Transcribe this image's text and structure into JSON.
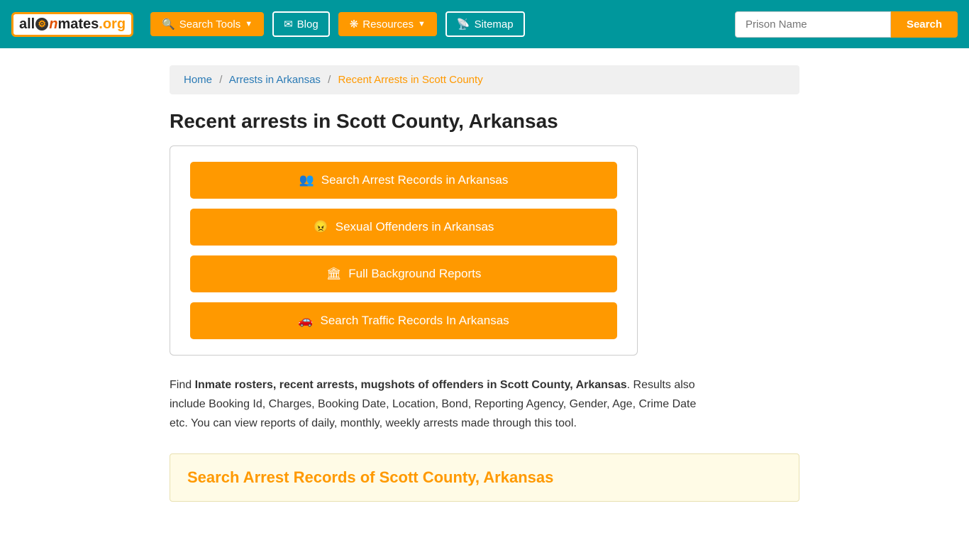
{
  "navbar": {
    "logo": {
      "text": "allInmates.org",
      "part1": "all",
      "part2": "In",
      "part3": "mates",
      "part4": ".org"
    },
    "search_tools_label": "Search Tools",
    "blog_label": "Blog",
    "resources_label": "Resources",
    "sitemap_label": "Sitemap",
    "prison_name_placeholder": "Prison Name",
    "search_btn_label": "Search"
  },
  "breadcrumb": {
    "home": "Home",
    "arrests_in_arkansas": "Arrests in Arkansas",
    "current": "Recent Arrests in Scott County"
  },
  "page": {
    "title": "Recent arrests in Scott County, Arkansas",
    "buttons": [
      {
        "id": "search-arrest",
        "icon": "👥",
        "label": "Search Arrest Records in Arkansas"
      },
      {
        "id": "sexual-offenders",
        "icon": "😠",
        "label": "Sexual Offenders in Arkansas"
      },
      {
        "id": "background-reports",
        "icon": "🏛",
        "label": "Full Background Reports"
      },
      {
        "id": "traffic-records",
        "icon": "🚗",
        "label": "Search Traffic Records In Arkansas"
      }
    ],
    "description_part1": "Find ",
    "description_bold": "Inmate rosters, recent arrests, mugshots of offenders in Scott County, Arkansas",
    "description_part2": ". Results also include Booking Id, Charges, Booking Date, Location, Bond, Reporting Agency, Gender, Age, Crime Date etc. You can view reports of daily, monthly, weekly arrests made through this tool.",
    "search_section_title": "Search Arrest Records of Scott County, Arkansas"
  }
}
